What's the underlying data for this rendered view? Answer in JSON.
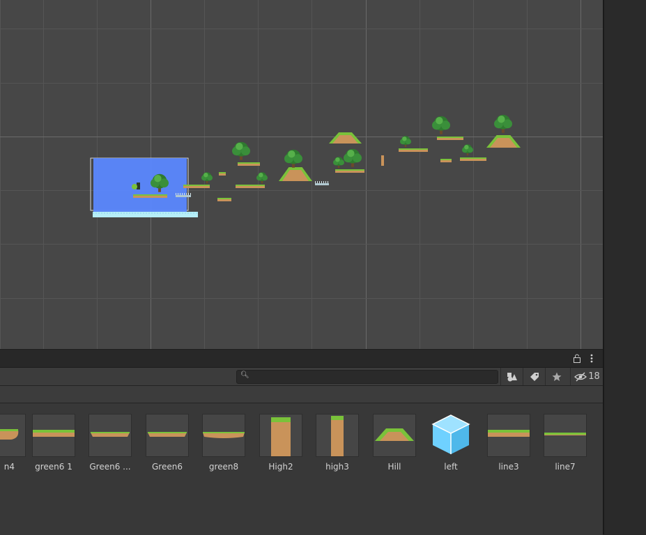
{
  "search": {
    "value": "",
    "placeholder": ""
  },
  "toolbar": {
    "hidden_packages_count": "18",
    "icons": [
      "lock-icon",
      "more-icon",
      "search-icon",
      "filter-by-type-icon",
      "filter-by-label-icon",
      "favorite-star-icon",
      "hidden-packages-icon"
    ]
  },
  "assets": [
    {
      "label": "n4",
      "thumb": "curve"
    },
    {
      "label": "green6 1",
      "thumb": "flat"
    },
    {
      "label": "Green6 ...",
      "thumb": "thin"
    },
    {
      "label": "Green6",
      "thumb": "thin"
    },
    {
      "label": "green8",
      "thumb": "thin2"
    },
    {
      "label": "High2",
      "thumb": "tall"
    },
    {
      "label": "high3",
      "thumb": "tall-narrow"
    },
    {
      "label": "Hill",
      "thumb": "hill"
    },
    {
      "label": "left",
      "thumb": "cube"
    },
    {
      "label": "line3",
      "thumb": "flat"
    },
    {
      "label": "line7",
      "thumb": "line"
    }
  ],
  "colors": {
    "scene_bg": "#474747",
    "grid": "#5a5a5a",
    "camera_fill": "#5b88ff",
    "grass": "#7ac23a",
    "dirt": "#c9935a",
    "water": "#b6eef8",
    "cube": "#6fd1ff"
  }
}
